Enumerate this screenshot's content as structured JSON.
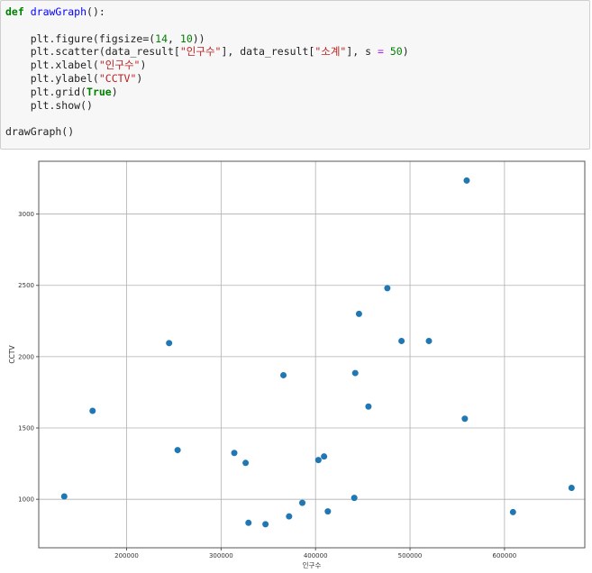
{
  "code_cell": {
    "line1": {
      "kw": "def",
      "fn": "drawGraph",
      "rest": "():"
    },
    "line2": "",
    "line3": {
      "a": "    plt.figure(figsize=(",
      "n1": "14",
      "b": ", ",
      "n2": "10",
      "c": "))"
    },
    "line4": {
      "a": "    plt.scatter(data_result[",
      "s1": "\"인구수\"",
      "b": "], data_result[",
      "s2": "\"소계\"",
      "c": "], s ",
      "op": "=",
      "d": " ",
      "n": "50",
      "e": ")"
    },
    "line5": {
      "a": "    plt.xlabel(",
      "s": "\"인구수\"",
      "b": ")"
    },
    "line6": {
      "a": "    plt.ylabel(",
      "s": "\"CCTV\"",
      "b": ")"
    },
    "line7": {
      "a": "    plt.grid(",
      "bool": "True",
      "b": ")"
    },
    "line8": "    plt.show()",
    "line9": "",
    "line10": "drawGraph()"
  },
  "chart_data": {
    "type": "scatter",
    "title": "",
    "xlabel": "인구수",
    "ylabel": "CCTV",
    "xlim": [
      107000,
      685000
    ],
    "ylim": [
      660000,
      3370
    ],
    "xlim_note": "",
    "x_ticks": [
      200000,
      300000,
      400000,
      500000,
      600000
    ],
    "y_ticks": [
      1000,
      1500,
      2000,
      2500,
      3000
    ],
    "grid": true,
    "marker_color": "#1f77b4",
    "points": [
      {
        "x": 134000,
        "y": 1020
      },
      {
        "x": 164000,
        "y": 1620
      },
      {
        "x": 245000,
        "y": 2095
      },
      {
        "x": 254000,
        "y": 1345
      },
      {
        "x": 314000,
        "y": 1325
      },
      {
        "x": 326000,
        "y": 1255
      },
      {
        "x": 329000,
        "y": 835
      },
      {
        "x": 347000,
        "y": 825
      },
      {
        "x": 366000,
        "y": 1870
      },
      {
        "x": 372000,
        "y": 880
      },
      {
        "x": 386000,
        "y": 975
      },
      {
        "x": 403000,
        "y": 1275
      },
      {
        "x": 409000,
        "y": 1300
      },
      {
        "x": 413000,
        "y": 915
      },
      {
        "x": 441000,
        "y": 1010
      },
      {
        "x": 442000,
        "y": 1885
      },
      {
        "x": 446000,
        "y": 2300
      },
      {
        "x": 456000,
        "y": 1650
      },
      {
        "x": 476000,
        "y": 2480
      },
      {
        "x": 491000,
        "y": 2110
      },
      {
        "x": 520000,
        "y": 2110
      },
      {
        "x": 558000,
        "y": 1565
      },
      {
        "x": 560000,
        "y": 3235
      },
      {
        "x": 609000,
        "y": 910
      },
      {
        "x": 671000,
        "y": 1080
      }
    ]
  }
}
